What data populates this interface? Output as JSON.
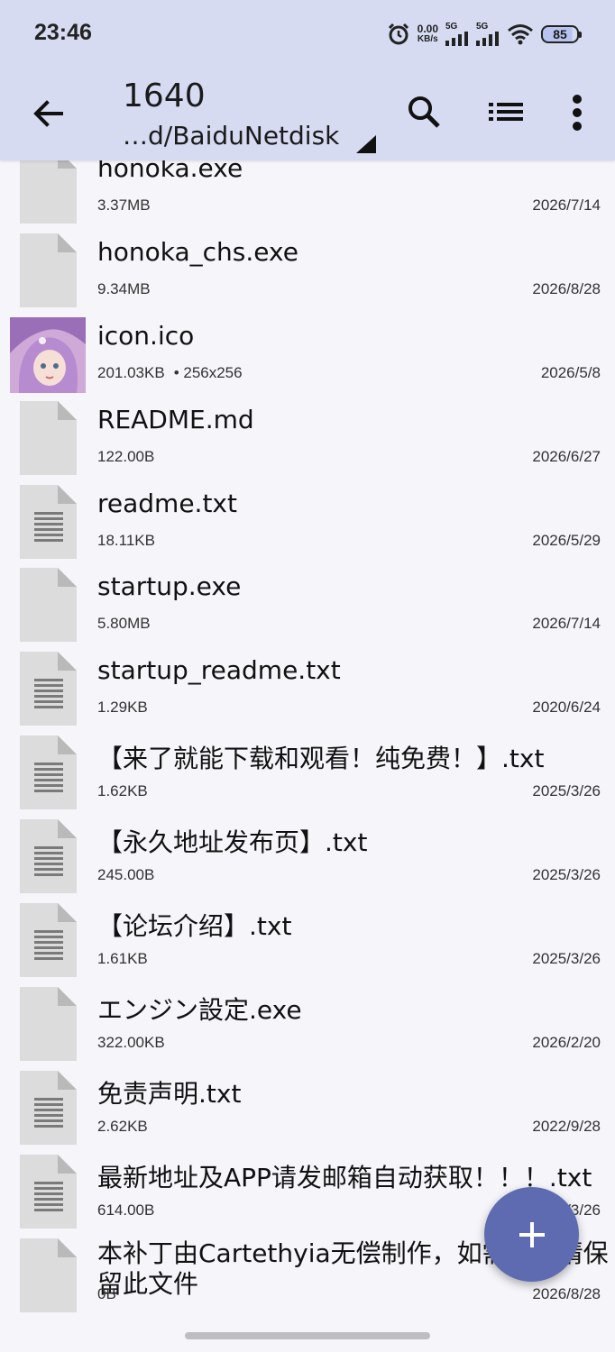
{
  "status_bar": {
    "time": "23:46",
    "speed_value": "0.00",
    "speed_unit": "KB/s",
    "sim1": "5G",
    "sim2": "5G",
    "battery": "85"
  },
  "app_bar": {
    "title": "1640",
    "path": "…d/BaiduNetdisk"
  },
  "files": [
    {
      "name": "honoka.exe",
      "size": "3.37MB",
      "date": "2026/7/14",
      "icon": "file-generic"
    },
    {
      "name": "honoka_chs.exe",
      "size": "9.34MB",
      "date": "2026/8/28",
      "icon": "file-generic"
    },
    {
      "name": "icon.ico",
      "size": "201.03KB",
      "dims": "• 256x256",
      "date": "2026/5/8",
      "icon": "image-thumbnail"
    },
    {
      "name": "README.md",
      "size": "122.00B",
      "date": "2026/6/27",
      "icon": "file-generic"
    },
    {
      "name": "readme.txt",
      "size": "18.11KB",
      "date": "2026/5/29",
      "icon": "file-text"
    },
    {
      "name": "startup.exe",
      "size": "5.80MB",
      "date": "2026/7/14",
      "icon": "file-generic"
    },
    {
      "name": "startup_readme.txt",
      "size": "1.29KB",
      "date": "2020/6/24",
      "icon": "file-text"
    },
    {
      "name": "【来了就能下载和观看！纯免费！】.txt",
      "size": "1.62KB",
      "date": "2025/3/26",
      "icon": "file-text"
    },
    {
      "name": "【永久地址发布页】.txt",
      "size": "245.00B",
      "date": "2025/3/26",
      "icon": "file-text"
    },
    {
      "name": "【论坛介绍】.txt",
      "size": "1.61KB",
      "date": "2025/3/26",
      "icon": "file-text"
    },
    {
      "name": "エンジン設定.exe",
      "size": "322.00KB",
      "date": "2026/2/20",
      "icon": "file-generic"
    },
    {
      "name": "免责声明.txt",
      "size": "2.62KB",
      "date": "2022/9/28",
      "icon": "file-text"
    },
    {
      "name": "最新地址及APP请发邮箱自动获取！！！.txt",
      "size": "614.00B",
      "date": "2025/3/26",
      "icon": "file-text"
    },
    {
      "name": "本补丁由Cartethyia无偿制作，如需转载请保留此文件",
      "size": "0B",
      "date": "2026/8/28",
      "icon": "file-generic"
    }
  ],
  "colors": {
    "app_bar_bg": "#d6dbf2",
    "fab_bg": "#5e6bb0",
    "page_bg": "#f5f5fa"
  },
  "icons": {
    "back": "arrow-left-icon",
    "search": "search-icon",
    "view": "list-view-icon",
    "more": "more-vert-icon",
    "fab": "plus-icon"
  }
}
